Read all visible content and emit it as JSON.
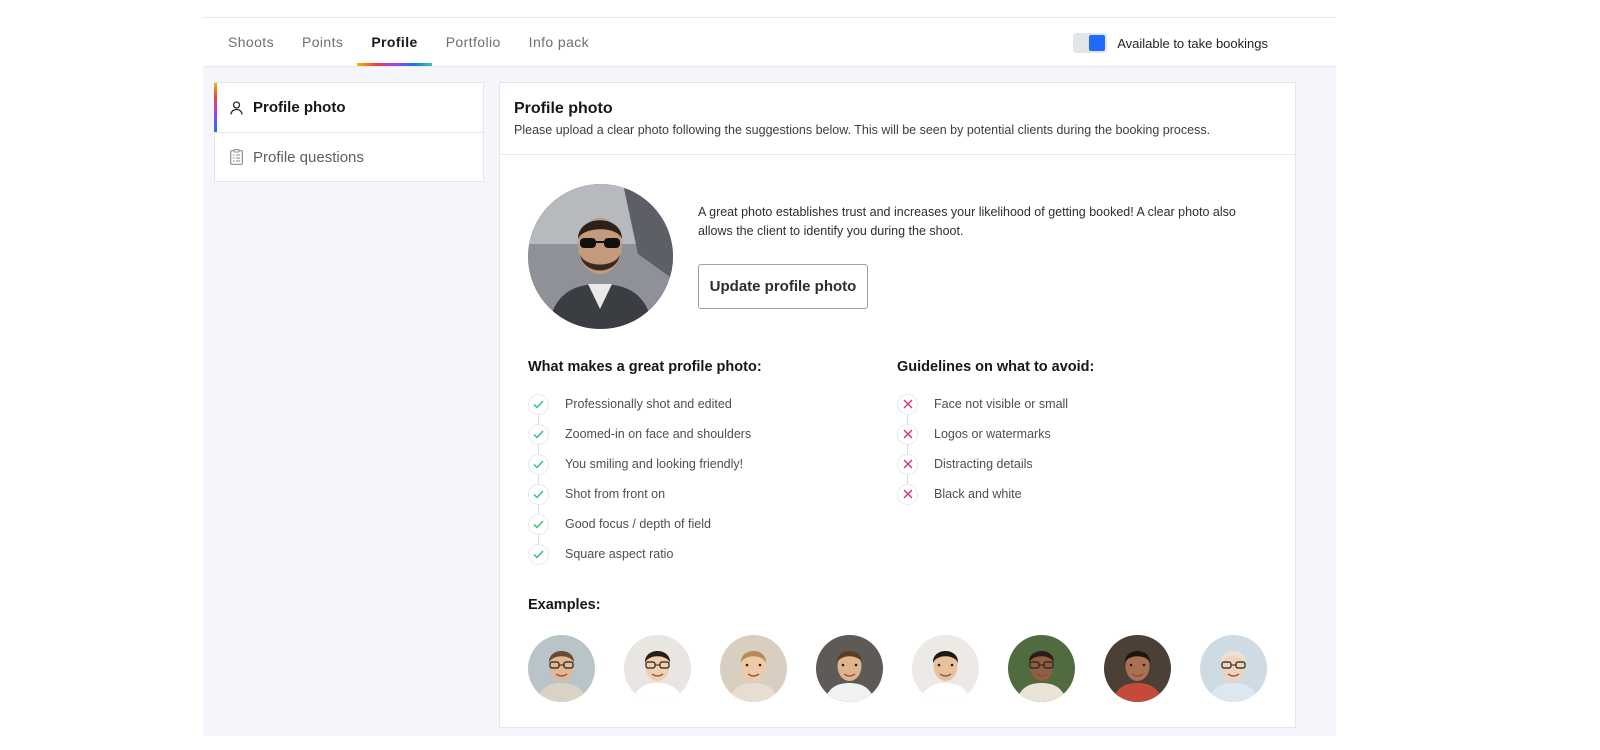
{
  "nav": {
    "tabs": [
      {
        "label": "Shoots",
        "active": false
      },
      {
        "label": "Points",
        "active": false
      },
      {
        "label": "Profile",
        "active": true
      },
      {
        "label": "Portfolio",
        "active": false
      },
      {
        "label": "Info pack",
        "active": false
      }
    ],
    "availability": {
      "label": "Available to take bookings",
      "on": true,
      "color": "#1f6bff"
    }
  },
  "sidebar": {
    "items": [
      {
        "label": "Profile photo",
        "icon": "user-icon",
        "active": true
      },
      {
        "label": "Profile questions",
        "icon": "clipboard-icon",
        "active": false
      }
    ]
  },
  "card": {
    "title": "Profile photo",
    "subtitle": "Please upload a clear photo following the suggestions below. This will be seen by potential clients during the booking process.",
    "hero_text": "A great photo establishes trust and increases your likelihood of getting booked! A clear photo also allows the client to identify you during the shoot.",
    "update_button": "Update profile photo",
    "good": {
      "heading": "What makes a great profile photo:",
      "items": [
        "Professionally shot and edited",
        "Zoomed-in on face and shoulders",
        "You smiling and looking friendly!",
        "Shot from front on",
        "Good focus / depth of field",
        "Square aspect ratio"
      ]
    },
    "bad": {
      "heading": "Guidelines on what to avoid:",
      "items": [
        "Face not visible or small",
        "Logos or watermarks",
        "Distracting details",
        "Black and white"
      ]
    },
    "examples_heading": "Examples:"
  },
  "colors": {
    "check": "#2fbf71",
    "cross": "#e0345a",
    "accent": "#1f6bff"
  }
}
